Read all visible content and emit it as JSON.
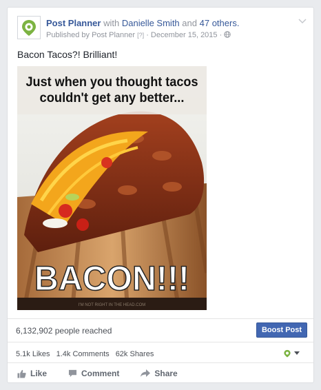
{
  "post": {
    "page_name": "Post Planner",
    "with_word": "with",
    "tagged_person": "Danielle Smith",
    "and_word": "and",
    "others_link": "47 others.",
    "published_prefix": "Published by",
    "published_by": "Post Planner",
    "question_mark": "[?]",
    "separator": "·",
    "date": "December 15, 2015",
    "separator2": "·",
    "text": "Bacon Tacos?! Brilliant!"
  },
  "photo": {
    "headline_line1": "Just when you thought tacos",
    "headline_line2": "couldn't get any better...",
    "big_text": "BACON!!!",
    "watermark": "I'M NOT RIGHT IN THE HEAD.COM"
  },
  "insights": {
    "reached": "6,132,902 people reached",
    "boost_label": "Boost Post"
  },
  "engagement": {
    "likes": "5.1k Likes",
    "comments": "1.4k Comments",
    "shares": "62k Shares"
  },
  "actions": {
    "like": "Like",
    "comment": "Comment",
    "share": "Share"
  },
  "colors": {
    "link": "#365899",
    "boost_bg": "#4267b2",
    "brand_green": "#7cb342"
  }
}
